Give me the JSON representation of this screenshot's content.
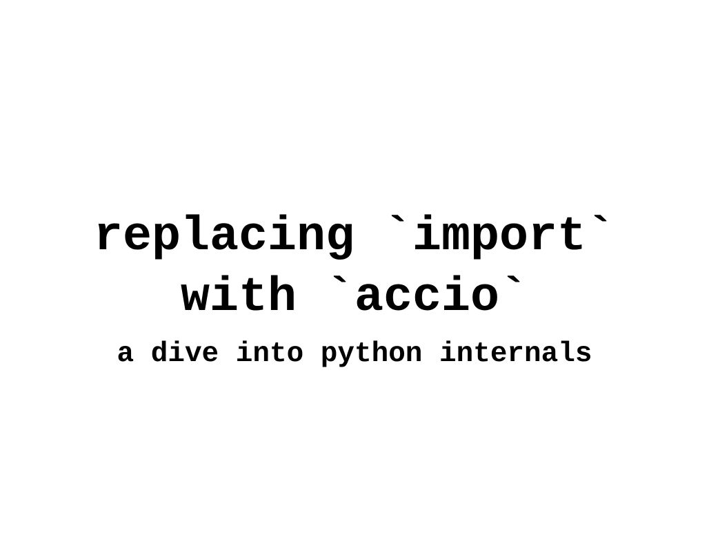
{
  "slide": {
    "title_line_1": "replacing `import`",
    "title_line_2": "with `accio`",
    "subtitle": "a dive into python internals"
  },
  "colors": {
    "background": "#ffffff",
    "text": "#000000"
  }
}
